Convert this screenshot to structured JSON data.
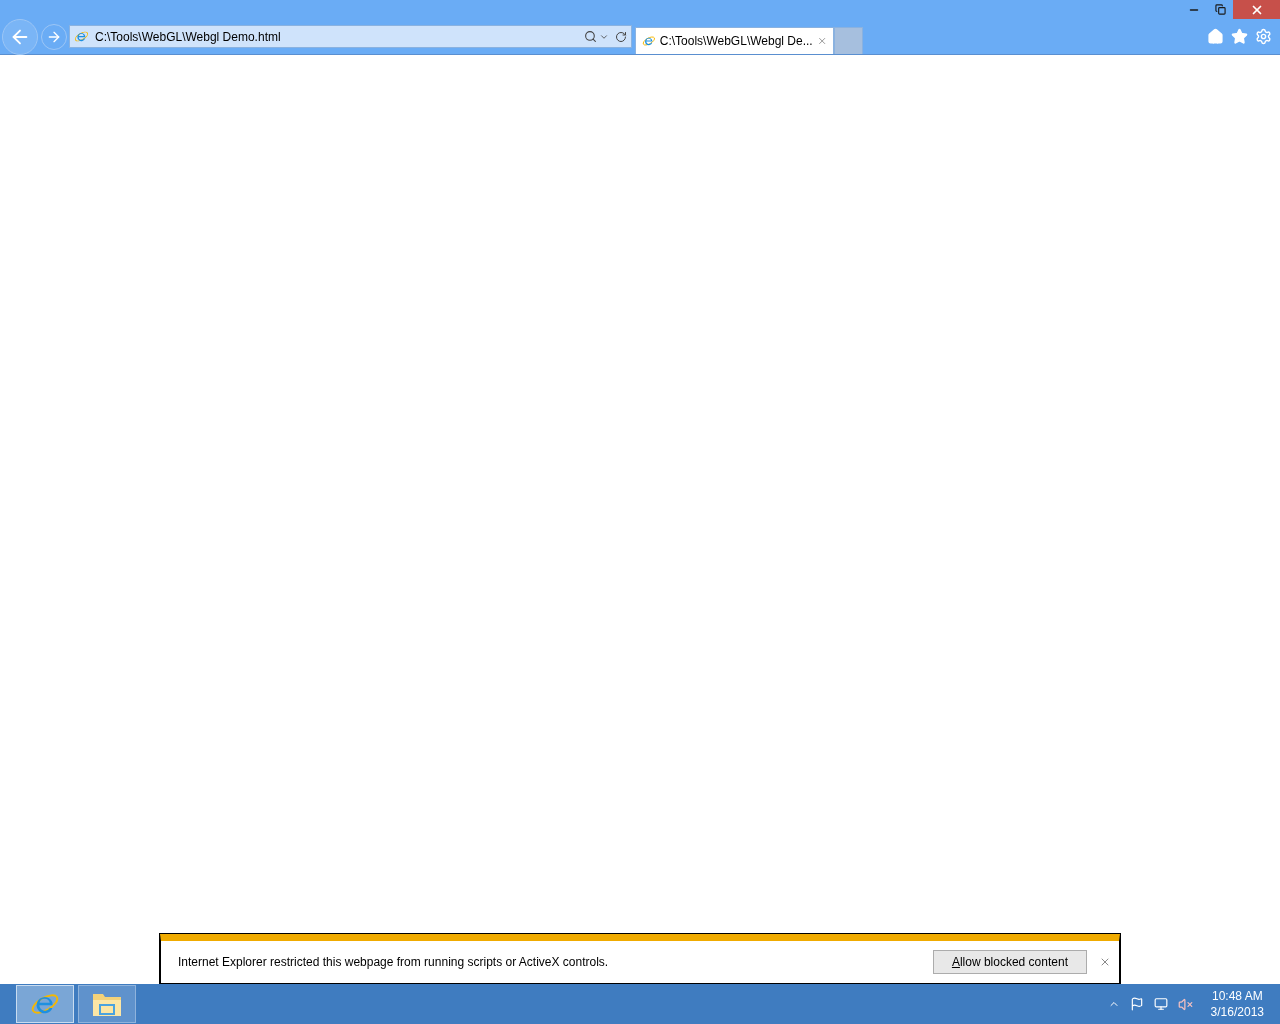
{
  "browser": {
    "address": "C:\\Tools\\WebGL\\Webgl Demo.html",
    "tabs": [
      {
        "title": "C:\\Tools\\WebGL\\Webgl De...",
        "selected": true
      }
    ]
  },
  "notification": {
    "message": "Internet Explorer restricted this webpage from running scripts or ActiveX controls.",
    "button": "Allow blocked content"
  },
  "taskbar": {
    "apps": [
      {
        "kind": "browser",
        "selected": true
      },
      {
        "kind": "files",
        "selected": false
      }
    ],
    "time": "10:48 AM",
    "date": "3/16/2013"
  }
}
